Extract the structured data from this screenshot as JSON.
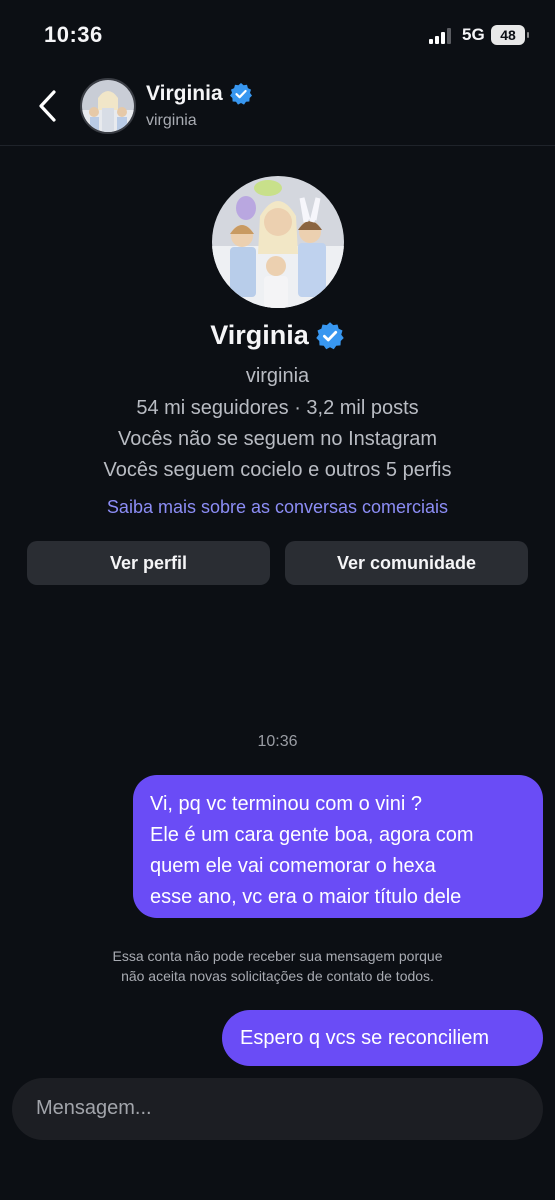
{
  "status_bar": {
    "time": "10:36",
    "network": "5G",
    "battery": "48"
  },
  "header": {
    "name": "Virginia",
    "handle": "virginia"
  },
  "profile": {
    "name": "Virginia",
    "handle": "virginia",
    "stats": "54 mi seguidores · 3,2 mil posts",
    "follow_status": "Vocês não se seguem no Instagram",
    "mutuals": "Vocês seguem cocielo e outros 5 perfis",
    "business_link": "Saiba mais sobre as conversas comerciais",
    "view_profile_label": "Ver perfil",
    "view_community_label": "Ver comunidade"
  },
  "conversation": {
    "timestamp": "10:36",
    "messages": [
      {
        "lines": [
          "Vi, pq vc terminou com o vini ?",
          "Ele é um cara gente boa, agora com",
          "quem ele vai comemorar o hexa",
          "esse ano, vc era o maior título dele"
        ]
      },
      {
        "text": "Espero q vcs se reconciliem"
      }
    ],
    "notice_lines": [
      "Essa conta não pode receber sua mensagem porque",
      "não aceita novas solicitações de contato de todos."
    ]
  },
  "composer": {
    "placeholder": "Mensagem..."
  },
  "colors": {
    "background": "#0c0f14",
    "bubble": "#6a4cf6",
    "link": "#8c8df5",
    "verified": "#3897f0",
    "button": "#2a2d33"
  }
}
